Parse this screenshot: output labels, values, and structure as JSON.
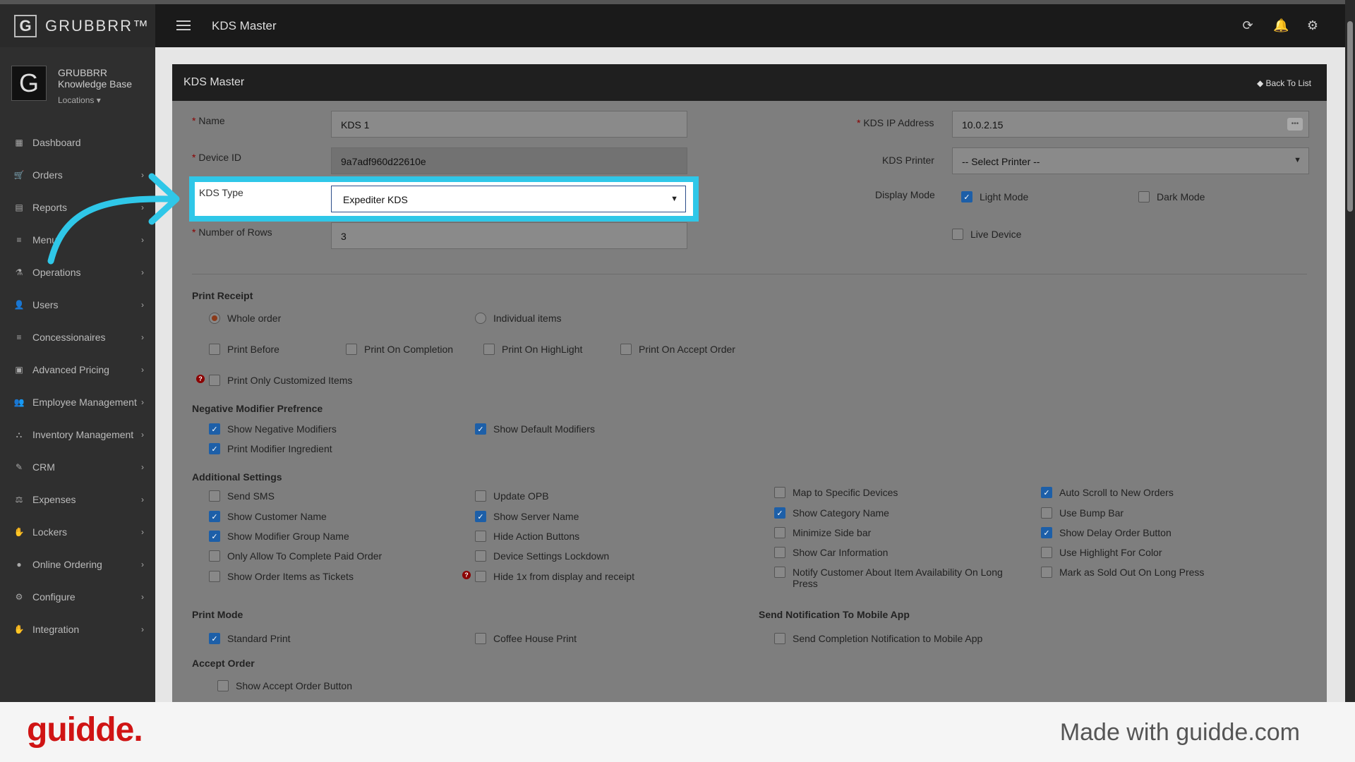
{
  "brand": {
    "name": "GRUBBRR™",
    "logo_letter": "G"
  },
  "topbar": {
    "title": "KDS Master",
    "icons": [
      "refresh-icon",
      "bell-icon",
      "gear-icon"
    ]
  },
  "profile": {
    "line1": "GRUBBRR",
    "line2": "Knowledge Base",
    "locations": "Locations ▾"
  },
  "sidebar": {
    "items": [
      {
        "label": "Dashboard",
        "icon": "▦",
        "chevron": false
      },
      {
        "label": "Orders",
        "icon": "🛒",
        "chevron": true
      },
      {
        "label": "Reports",
        "icon": "▤",
        "chevron": true
      },
      {
        "label": "Menu",
        "icon": "≡",
        "chevron": true
      },
      {
        "label": "Operations",
        "icon": "⚗",
        "chevron": true
      },
      {
        "label": "Users",
        "icon": "👤",
        "chevron": true
      },
      {
        "label": "Concessionaires",
        "icon": "≡",
        "chevron": true
      },
      {
        "label": "Advanced Pricing",
        "icon": "▣",
        "chevron": true
      },
      {
        "label": "Employee Management",
        "icon": "👥",
        "chevron": true
      },
      {
        "label": "Inventory Management",
        "icon": "⛬",
        "chevron": true
      },
      {
        "label": "CRM",
        "icon": "✎",
        "chevron": true
      },
      {
        "label": "Expenses",
        "icon": "⚖",
        "chevron": true
      },
      {
        "label": "Lockers",
        "icon": "✋",
        "chevron": true
      },
      {
        "label": "Online Ordering",
        "icon": "●",
        "chevron": true
      },
      {
        "label": "Configure",
        "icon": "⚙",
        "chevron": true
      },
      {
        "label": "Integration",
        "icon": "✋",
        "chevron": true
      }
    ]
  },
  "panel": {
    "title": "KDS Master",
    "back": "◆ Back To List"
  },
  "form": {
    "name_label": "Name",
    "name_value": "KDS 1",
    "device_label": "Device ID",
    "device_value": "9a7adf960d22610e",
    "type_label": "KDS Type",
    "type_value": "Expediter KDS",
    "rows_label": "Number of Rows",
    "rows_value": "3",
    "ip_label": "KDS IP Address",
    "ip_value": "10.0.2.15",
    "printer_label": "KDS Printer",
    "printer_value": "-- Select Printer --",
    "display_label": "Display Mode",
    "light": "Light Mode",
    "dark": "Dark Mode",
    "live": "Live Device",
    "required_mark": "*"
  },
  "print_receipt": {
    "title": "Print Receipt",
    "whole": "Whole order",
    "individual": "Individual items",
    "before": "Print Before",
    "completion": "Print On Completion",
    "highlight": "Print On HighLight",
    "accept": "Print On Accept Order",
    "customized": "Print Only Customized Items"
  },
  "negative": {
    "title": "Negative Modifier Prefrence",
    "show_neg": "Show Negative Modifiers",
    "show_default": "Show Default Modifiers",
    "ingredient": "Print Modifier Ingredient"
  },
  "additional": {
    "title": "Additional Settings",
    "c1": [
      "Send SMS",
      "Show Customer Name",
      "Show Modifier Group Name",
      "Only Allow To Complete Paid Order",
      "Show Order Items as Tickets"
    ],
    "c2": [
      "Update OPB",
      "Show Server Name",
      "Hide Action Buttons",
      "Device Settings Lockdown",
      "Hide 1x from display and receipt"
    ],
    "c3": [
      "Map to Specific Devices",
      "Show Category Name",
      "Minimize Side bar",
      "Show Car Information",
      "Notify Customer About Item Availability On Long Press"
    ],
    "c4": [
      "Auto Scroll to New Orders",
      "Use Bump Bar",
      "Show Delay Order Button",
      "Use Highlight For Color",
      "Mark as Sold Out On Long Press"
    ]
  },
  "print_mode": {
    "title": "Print Mode",
    "standard": "Standard Print",
    "coffee": "Coffee House Print"
  },
  "notification": {
    "title": "Send Notification To Mobile App",
    "completion": "Send Completion Notification to Mobile App"
  },
  "accept_order": {
    "title": "Accept Order",
    "show": "Show Accept Order Button"
  },
  "footer": {
    "logo": "guidde.",
    "made": "Made with guidde.com"
  },
  "colors": {
    "highlight": "#2fc7e8",
    "checkbox_on": "#1d5fa8",
    "brand_red": "#d01414"
  }
}
